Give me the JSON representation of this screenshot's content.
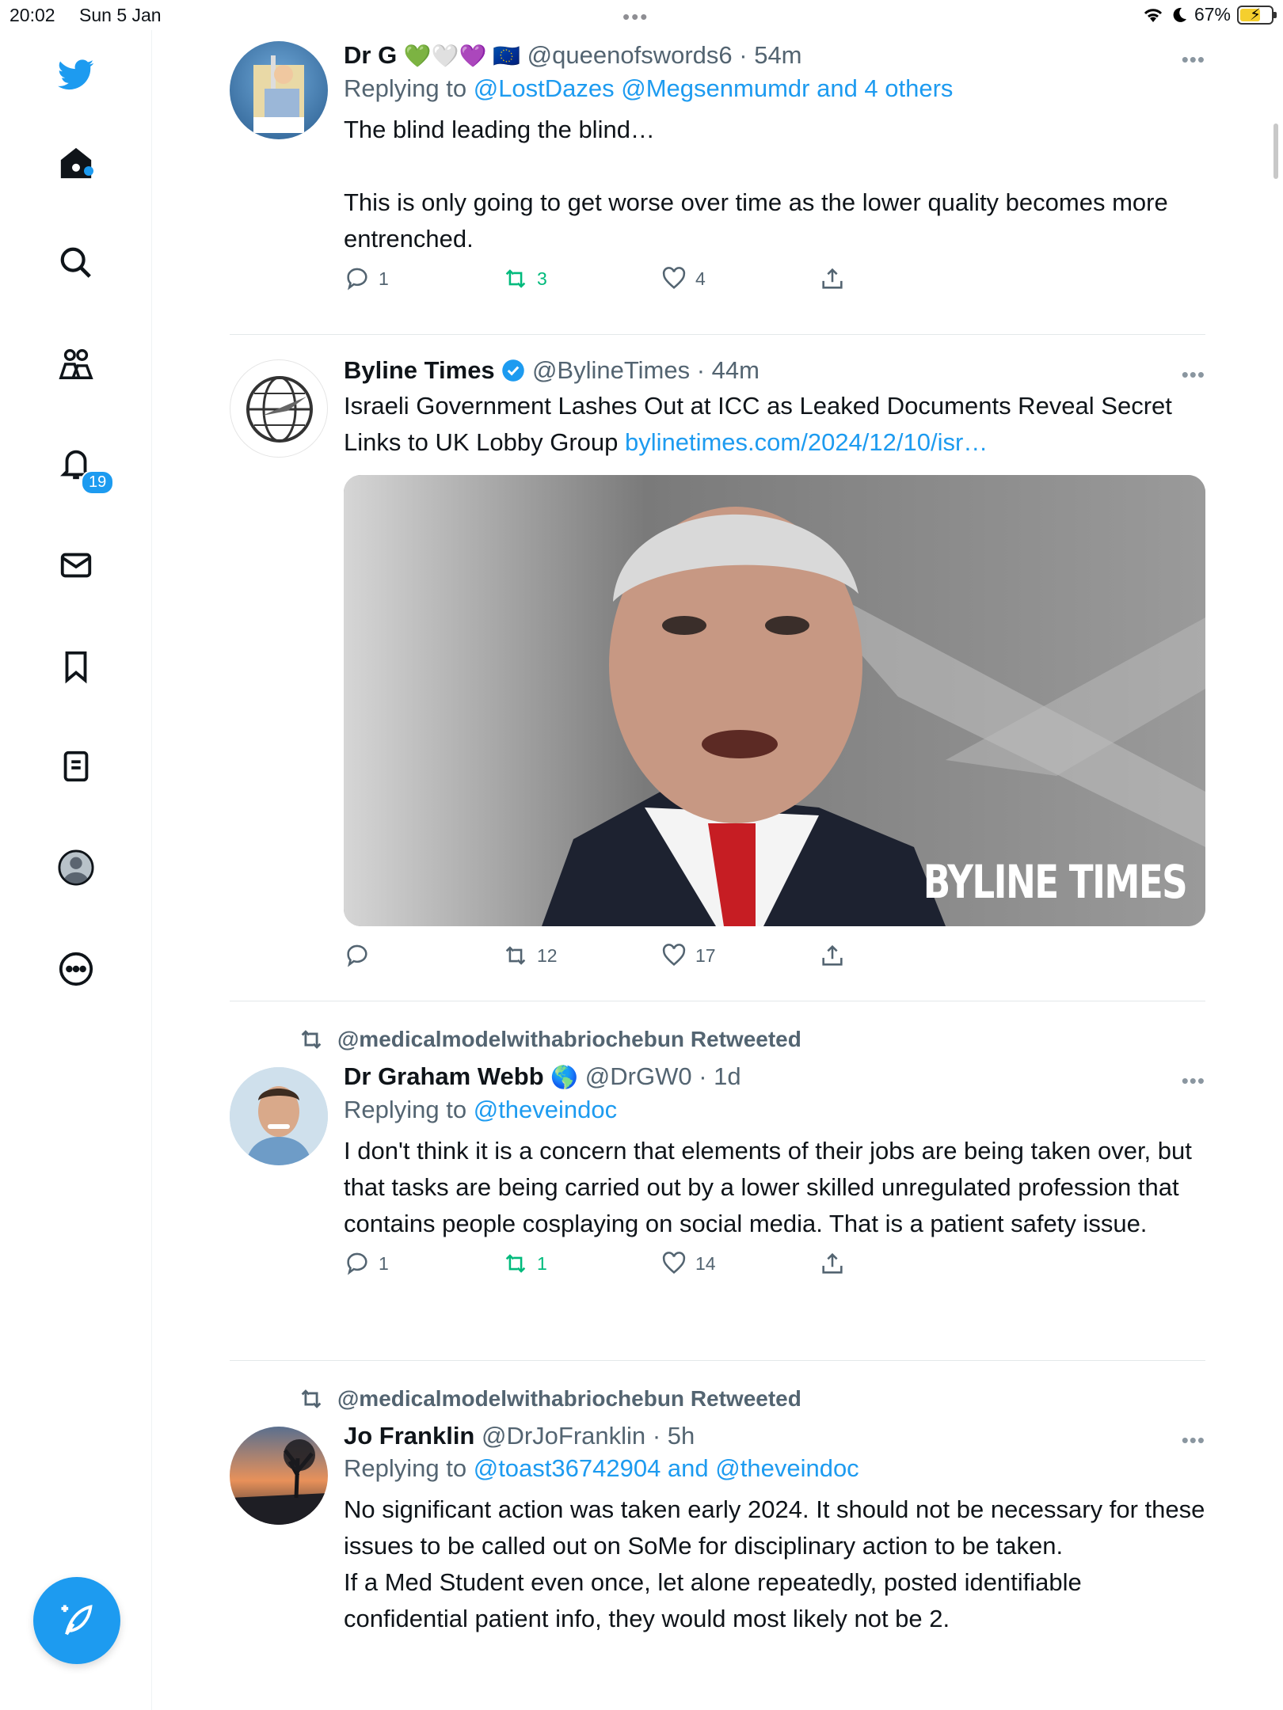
{
  "status_bar": {
    "time": "20:02",
    "date": "Sun 5 Jan",
    "battery": "67%"
  },
  "sidebar": {
    "notification_badge": "19"
  },
  "tweets": [
    {
      "name": "Dr G",
      "emojis": "💚🤍💜 🇪🇺",
      "handle": "@queenofswords6",
      "time": "· 54m",
      "replying_prefix": "Replying to ",
      "replying_to": "@LostDazes @Megsenmumdr and 4 others",
      "text": "The blind leading the blind…\n\nThis is only going to get worse over time as the lower quality becomes more entrenched.",
      "replies": "1",
      "retweets": "3",
      "likes": "4"
    },
    {
      "name": "Byline Times",
      "handle": "@BylineTimes",
      "time": "· 44m",
      "text": "Israeli Government Lashes Out at ICC as Leaked Documents Reveal Secret Links to UK Lobby Group ",
      "link": "bylinetimes.com/2024/12/10/isr…",
      "media_watermark": "BYLINE TIMES",
      "replies": "",
      "retweets": "12",
      "likes": "17"
    },
    {
      "retweeted_by": "@medicalmodelwithabriochebun Retweeted",
      "name": "Dr Graham Webb",
      "emojis": "🌎",
      "handle": "@DrGW0",
      "time": "· 1d",
      "replying_prefix": "Replying to ",
      "replying_to": "@theveindoc",
      "text": "I don't think it is a concern that elements of their jobs are being taken over, but that tasks are being carried out by a lower skilled unregulated profession that contains people cosplaying on social media. That is a patient safety issue.",
      "replies": "1",
      "retweets": "1",
      "likes": "14"
    },
    {
      "retweeted_by": "@medicalmodelwithabriochebun Retweeted",
      "name": "Jo Franklin",
      "handle": "@DrJoFranklin",
      "time": "· 5h",
      "replying_prefix": "Replying to ",
      "replying_to": "@toast36742904 and @theveindoc",
      "text": "No significant action was taken early 2024. It should not be necessary for these issues to be called out on SoMe for disciplinary action to be taken.\nIf a Med Student even once, let alone repeatedly, posted identifiable confidential patient info, they would most likely not be 2."
    }
  ],
  "colors": {
    "accent": "#1d9bf0",
    "retweet_green": "#00ba7c",
    "muted": "#536471"
  }
}
